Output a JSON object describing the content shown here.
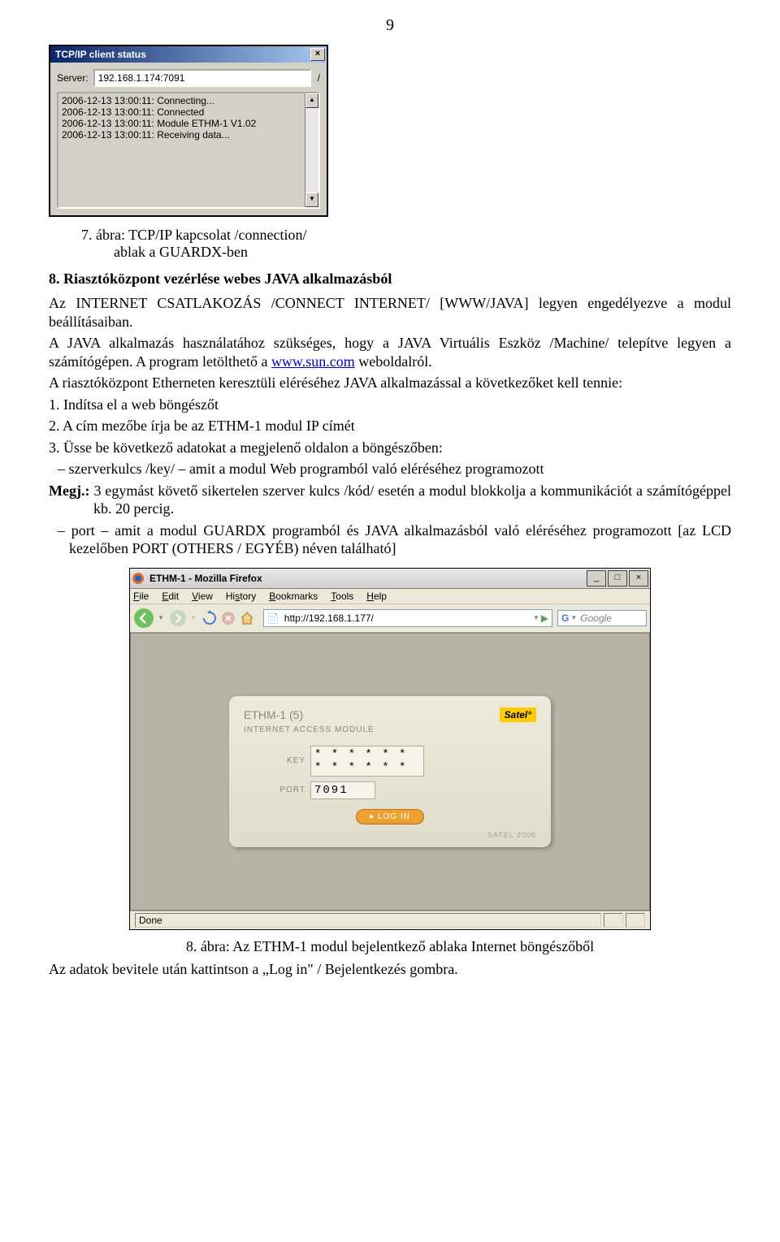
{
  "page_number": "9",
  "figure1": {
    "window_title": "TCP/IP client status",
    "server_label": "Server:",
    "server_value": "192.168.1.174:7091",
    "separator": "/",
    "log_lines": [
      "2006-12-13 13:00:11: Connecting...",
      "2006-12-13 13:00:11: Connected",
      "2006-12-13 13:00:11: Module ETHM-1 V1.02",
      "2006-12-13 13:00:11: Receiving data..."
    ],
    "caption_line1": "7. ábra: TCP/IP kapcsolat /connection/",
    "caption_line2": "ablak a GUARDX-ben"
  },
  "heading8": "8. Riasztóközpont vezérlése webes JAVA alkalmazásból",
  "para1": "Az INTERNET CSATLAKOZÁS /CONNECT INTERNET/ [WWW/JAVA] legyen engedélyezve a modul beállításaiban.",
  "para2_a": "A JAVA alkalmazás használatához szükséges, hogy a JAVA Virtuális Eszköz /Machine/ telepítve legyen a számítógépen. A program letölthető a ",
  "para2_link": "www.sun.com",
  "para2_b": " weboldalról.",
  "para3": "A riasztóközpont Etherneten keresztüli eléréséhez JAVA alkalmazással a következőket kell tennie:",
  "step1": "1. Indítsa el a web böngészőt",
  "step2": "2. A cím mezőbe írja be az ETHM-1 modul IP címét",
  "step3": "3. Üsse be következő adatokat a megjelenő oldalon a böngészőben:",
  "dash1": "– szerverkulcs /key/ – amit a modul Web programból való eléréséhez programozott",
  "note_label": "Megj.:",
  "note_text": " 3 egymást követő sikertelen szerver kulcs /kód/ esetén a modul blokkolja a kommunikációt a számítógéppel kb. 20 percig.",
  "dash2": "– port – amit a modul GUARDX programból és JAVA alkalmazásból való eléréséhez programozott [az LCD kezelőben PORT (OTHERS / EGYÉB) néven található]",
  "figure2": {
    "title": "ETHM-1      - Mozilla Firefox",
    "menu": {
      "file": "File",
      "edit": "Edit",
      "view": "View",
      "history": "History",
      "bookmarks": "Bookmarks",
      "tools": "Tools",
      "help": "Help"
    },
    "url": "http://192.168.1.177/",
    "search_engine": "G",
    "search_placeholder": "Google",
    "login": {
      "title": "ETHM-1 (5)",
      "subtitle": "INTERNET ACCESS MODULE",
      "logo": "Satel°",
      "key_label": "KEY",
      "key_value": "* * * * * * * * * * * *",
      "port_label": "PORT",
      "port_value": "7091",
      "login_btn": "▸ LOG IN",
      "footer": "SATEL 2005"
    },
    "status": "Done"
  },
  "caption2": "8. ábra: Az ETHM-1 modul bejelentkező ablaka Internet böngészőből",
  "final": "Az adatok bevitele után kattintson a „Log in\" / Bejelentkezés gombra."
}
